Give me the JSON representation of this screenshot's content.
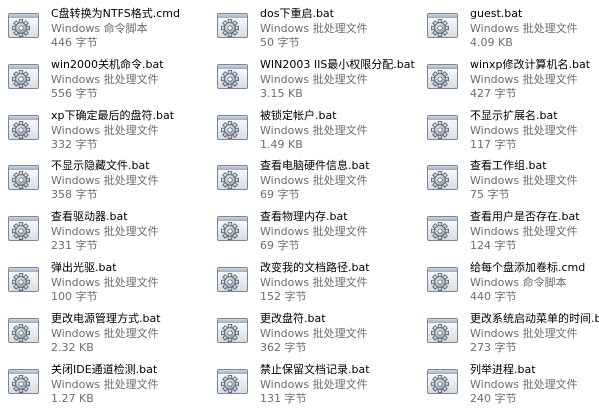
{
  "files": [
    {
      "name": "C盘转换为NTFS格式.cmd",
      "type": "Windows 命令脚本",
      "size": "446 字节"
    },
    {
      "name": "dos下重启.bat",
      "type": "Windows 批处理文件",
      "size": "50 字节"
    },
    {
      "name": "guest.bat",
      "type": "Windows 批处理文件",
      "size": "4.09 KB"
    },
    {
      "name": "win2000关机命令.bat",
      "type": "Windows 批处理文件",
      "size": "556 字节"
    },
    {
      "name": "WIN2003 IIS最小权限分配.bat",
      "type": "Windows 批处理文件",
      "size": "3.15 KB"
    },
    {
      "name": "winxp修改计算机名.bat",
      "type": "Windows 批处理文件",
      "size": "427 字节"
    },
    {
      "name": "xp下确定最后的盘符.bat",
      "type": "Windows 批处理文件",
      "size": "332 字节"
    },
    {
      "name": "被锁定帐户.bat",
      "type": "Windows 批处理文件",
      "size": "1.49 KB"
    },
    {
      "name": "不显示扩展名.bat",
      "type": "Windows 批处理文件",
      "size": "117 字节"
    },
    {
      "name": "不显示隐藏文件.bat",
      "type": "Windows 批处理文件",
      "size": "358 字节"
    },
    {
      "name": "查看电脑硬件信息.bat",
      "type": "Windows 批处理文件",
      "size": "69 字节"
    },
    {
      "name": "查看工作组.bat",
      "type": "Windows 批处理文件",
      "size": "75 字节"
    },
    {
      "name": "查看驱动器.bat",
      "type": "Windows 批处理文件",
      "size": "231 字节"
    },
    {
      "name": "查看物理内存.bat",
      "type": "Windows 批处理文件",
      "size": "69 字节"
    },
    {
      "name": "查看用户是否存在.bat",
      "type": "Windows 批处理文件",
      "size": "124 字节"
    },
    {
      "name": "弹出光驱.bat",
      "type": "Windows 批处理文件",
      "size": "100 字节"
    },
    {
      "name": "改变我的文档路径.bat",
      "type": "Windows 批处理文件",
      "size": "152 字节"
    },
    {
      "name": "给每个盘添加卷标.cmd",
      "type": "Windows 命令脚本",
      "size": "440 字节"
    },
    {
      "name": "更改电源管理方式.bat",
      "type": "Windows 批处理文件",
      "size": "2.32 KB"
    },
    {
      "name": "更改盘符.bat",
      "type": "Windows 批处理文件",
      "size": "362 字节"
    },
    {
      "name": "更改系统启动菜单的时间.bat",
      "type": "Windows 批处理文件",
      "size": "273 字节"
    },
    {
      "name": "关闭IDE通道检测.bat",
      "type": "Windows 批处理文件",
      "size": "1.27 KB"
    },
    {
      "name": "禁止保留文档记录.bat",
      "type": "Windows 批处理文件",
      "size": "131 字节"
    },
    {
      "name": "列举进程.bat",
      "type": "Windows 批处理文件",
      "size": "240 字节"
    }
  ]
}
